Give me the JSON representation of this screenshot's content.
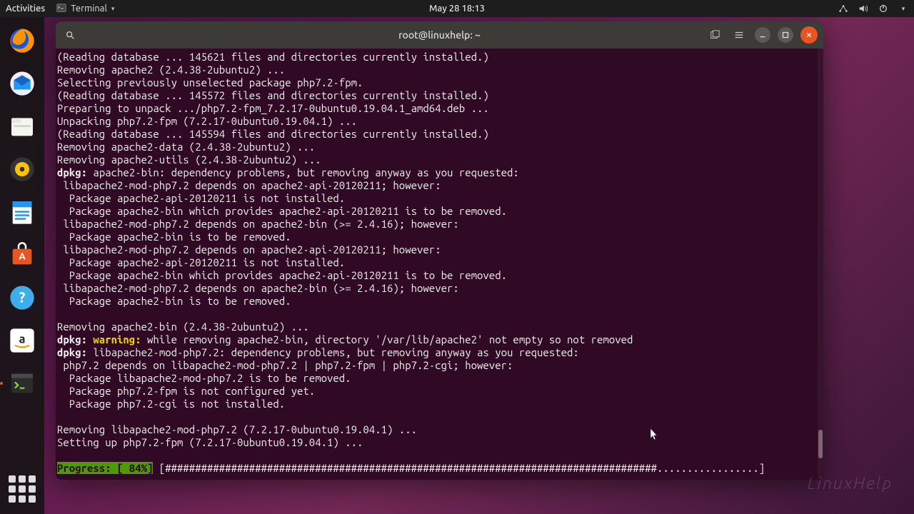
{
  "topbar": {
    "activities": "Activities",
    "app_name": "Terminal",
    "datetime": "May 28  18:13"
  },
  "window": {
    "title": "root@linuxhelp: ~"
  },
  "terminal": {
    "lines": [
      "(Reading database ... 145621 files and directories currently installed.)",
      "Removing apache2 (2.4.38-2ubuntu2) ...",
      "Selecting previously unselected package php7.2-fpm.",
      "(Reading database ... 145572 files and directories currently installed.)",
      "Preparing to unpack .../php7.2-fpm_7.2.17-0ubuntu0.19.04.1_amd64.deb ...",
      "Unpacking php7.2-fpm (7.2.17-0ubuntu0.19.04.1) ...",
      "(Reading database ... 145594 files and directories currently installed.)",
      "Removing apache2-data (2.4.38-2ubuntu2) ...",
      "Removing apache2-utils (2.4.38-2ubuntu2) ..."
    ],
    "dpkg1_prefix": "dpkg:",
    "dpkg1_rest": " apache2-bin: dependency problems, but removing anyway as you requested:",
    "dep_block1": [
      " libapache2-mod-php7.2 depends on apache2-api-20120211; however:",
      "  Package apache2-api-20120211 is not installed.",
      "  Package apache2-bin which provides apache2-api-20120211 is to be removed.",
      " libapache2-mod-php7.2 depends on apache2-bin (>= 2.4.16); however:",
      "  Package apache2-bin is to be removed.",
      " libapache2-mod-php7.2 depends on apache2-api-20120211; however:",
      "  Package apache2-api-20120211 is not installed.",
      "  Package apache2-bin which provides apache2-api-20120211 is to be removed.",
      " libapache2-mod-php7.2 depends on apache2-bin (>= 2.4.16); however:",
      "  Package apache2-bin is to be removed.",
      "",
      "Removing apache2-bin (2.4.38-2ubuntu2) ..."
    ],
    "dpkg_warn_prefix": "dpkg: ",
    "dpkg_warn_word": "warning:",
    "dpkg_warn_rest": " while removing apache2-bin, directory '/var/lib/apache2' not empty so not removed",
    "dpkg2_prefix": "dpkg:",
    "dpkg2_rest": " libapache2-mod-php7.2: dependency problems, but removing anyway as you requested:",
    "dep_block2": [
      " php7.2 depends on libapache2-mod-php7.2 | php7.2-fpm | php7.2-cgi; however:",
      "  Package libapache2-mod-php7.2 is to be removed.",
      "  Package php7.2-fpm is not configured yet.",
      "  Package php7.2-cgi is not installed.",
      "",
      "Removing libapache2-mod-php7.2 (7.2.17-0ubuntu0.19.04.1) ...",
      "Setting up php7.2-fpm (7.2.17-0ubuntu0.19.04.1) ..."
    ],
    "progress_label": "Progress: [ 84%]",
    "progress_bar": " [##################################################################################.................] "
  },
  "watermark": "LinuxHelp"
}
